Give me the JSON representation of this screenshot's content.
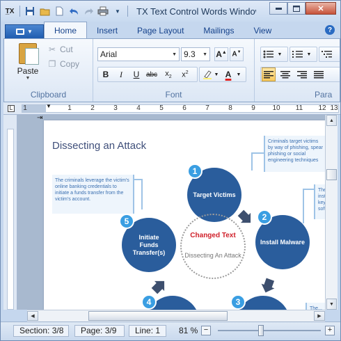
{
  "window": {
    "title": "TX Text Control Words Window..."
  },
  "tabs": [
    {
      "label": "Home",
      "active": true
    },
    {
      "label": "Insert",
      "active": false
    },
    {
      "label": "Page Layout",
      "active": false
    },
    {
      "label": "Mailings",
      "active": false
    },
    {
      "label": "View",
      "active": false
    }
  ],
  "clipboard": {
    "paste": "Paste",
    "cut": "Cut",
    "copy": "Copy",
    "label": "Clipboard"
  },
  "font": {
    "name": "Arial",
    "size": "9.3",
    "label": "Font"
  },
  "paragraph": {
    "label": "Para"
  },
  "ruler": {
    "numbers": [
      "1",
      "1",
      "2",
      "3",
      "4",
      "5",
      "6",
      "7",
      "8",
      "9",
      "10",
      "11",
      "12",
      "13"
    ]
  },
  "doc": {
    "title": "Dissecting an Attack",
    "callout_right": "Criminals target victims by way of phishing, spear phishing or social engineering techniques",
    "callout_left": "The criminals leverage the victim's online banking credentials to initiate a funds transfer from the victim's account.",
    "callout_right2": "The install keylogging software...",
    "callout_right3": "The...",
    "nodes": [
      {
        "num": "1",
        "label": "Target Victims"
      },
      {
        "num": "2",
        "label": "Install Malware"
      },
      {
        "num": "3",
        "label": ""
      },
      {
        "num": "4",
        "label": ""
      },
      {
        "num": "5",
        "label": "Initiate Funds Transfer(s)"
      }
    ],
    "center": {
      "changed": "Changed Text",
      "subtitle": "Dissecting An Attack"
    }
  },
  "status": {
    "section": "Section: 3/8",
    "page": "Page: 3/9",
    "line": "Line: 1",
    "zoom": "81 %"
  },
  "colors": {
    "accent": "#2a5d9c",
    "badge": "#3a9ee2",
    "changed": "#d0202a",
    "callout_text": "#3a6fb0"
  }
}
